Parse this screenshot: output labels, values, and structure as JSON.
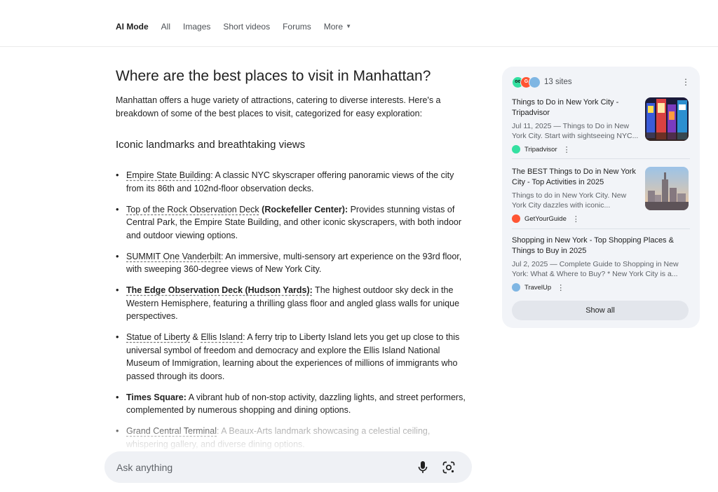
{
  "nav": {
    "tabs": [
      {
        "label": "AI Mode",
        "active": true
      },
      {
        "label": "All"
      },
      {
        "label": "Images"
      },
      {
        "label": "Short videos"
      },
      {
        "label": "Forums"
      },
      {
        "label": "More"
      }
    ]
  },
  "answer": {
    "question": "Where are the best places to visit in Manhattan?",
    "intro": "Manhattan offers a huge variety of attractions, catering to diverse interests. Here's a breakdown of some of the best places to visit, categorized for easy exploration:",
    "section_heading": "Iconic landmarks and breathtaking views",
    "items": [
      {
        "term": "Empire State Building",
        "term_suffix": ":",
        "text": " A classic NYC skyscraper offering panoramic views of the city from its 86th and 102nd-floor observation decks."
      },
      {
        "term": "Top of the Rock Observation Deck",
        "term_suffix": " (Rockefeller Center):",
        "text": " Provides stunning vistas of Central Park, the Empire State Building, and other iconic skyscrapers, with both indoor and outdoor viewing options."
      },
      {
        "term": "SUMMIT One Vanderbilt",
        "term_suffix": ":",
        "text": " An immersive, multi-sensory art experience on the 93rd floor, with sweeping 360-degree views of New York City."
      },
      {
        "term": "The Edge Observation Deck (Hudson Yards):",
        "term_suffix": "",
        "text": " The highest outdoor sky deck in the Western Hemisphere, featuring a thrilling glass floor and angled glass walls for unique perspectives."
      },
      {
        "term": "Statue of Liberty",
        "middle": " & ",
        "term2": "Ellis Island",
        "term_suffix": ":",
        "text": " A ferry trip to Liberty Island lets you get up close to this universal symbol of freedom and democracy and explore the Ellis Island National Museum of Immigration, learning about the experiences of millions of immigrants who passed through its doors."
      },
      {
        "term": "Times Square:",
        "text": " A vibrant hub of non-stop activity, dazzling lights, and street performers, complemented by numerous shopping and dining options."
      },
      {
        "term": "Grand Central Terminal",
        "term_suffix": ":",
        "text": " A Beaux-Arts landmark showcasing a celestial ceiling, whispering gallery, and diverse dining options."
      }
    ]
  },
  "ask": {
    "placeholder": "Ask anything"
  },
  "sources": {
    "count_label": "13 sites",
    "cards": [
      {
        "title": "Things to Do in New York City - Tripadvisor",
        "snippet": "Jul 11, 2025 — Things to Do in New York City. Start with sightseeing NYC...",
        "source_name": "Tripadvisor",
        "source_color": "#34e0a1"
      },
      {
        "title": "The BEST Things to Do in New York City - Top Activities in 2025",
        "snippet": "Things to do in New York City. New York City dazzles with iconic...",
        "source_name": "GetYourGuide",
        "source_color": "#ff5533"
      },
      {
        "title": "Shopping in New York - Top Shopping Places & Things to Buy in 2025",
        "snippet": "Jul 2, 2025 — Complete Guide to Shopping in New York: What & Where to Buy? * New York City is a...",
        "source_name": "TravelUp",
        "source_color": "#7fb6e3"
      }
    ],
    "show_all_label": "Show all"
  }
}
